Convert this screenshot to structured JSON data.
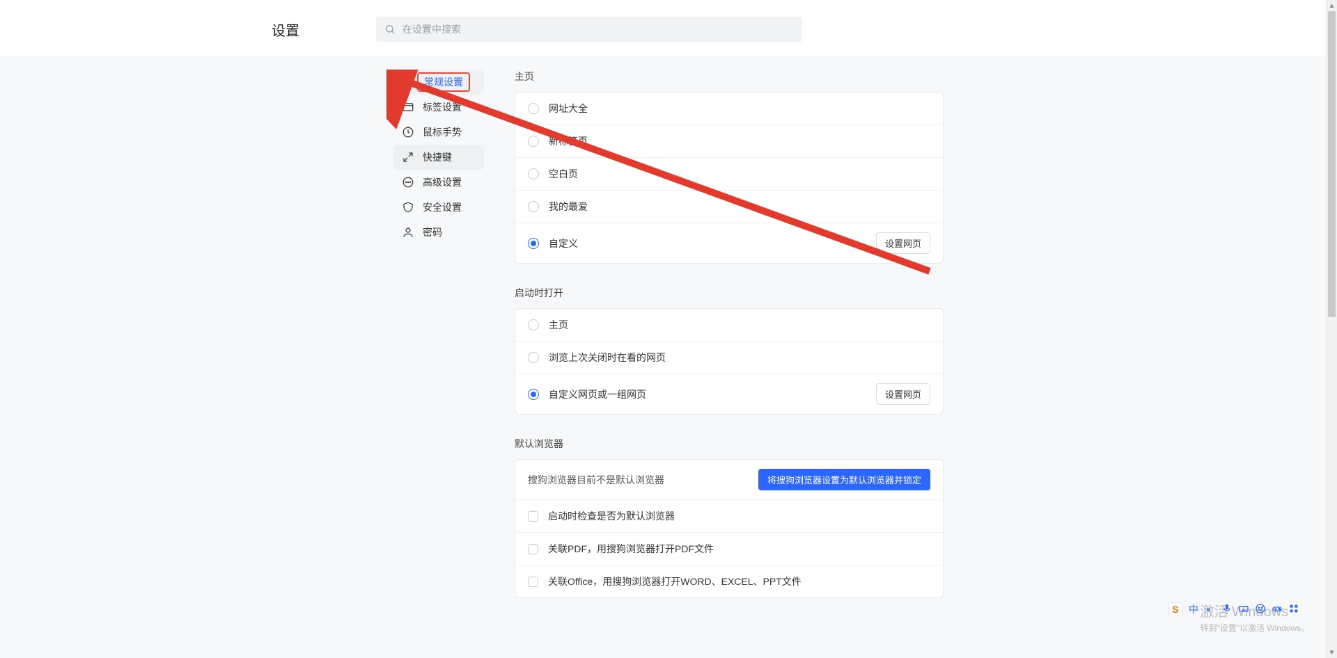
{
  "header": {
    "title": "设置",
    "search_placeholder": "在设置中搜索"
  },
  "sidebar": {
    "items": [
      {
        "id": "general",
        "label": "常规设置"
      },
      {
        "id": "tabs",
        "label": "标签设置"
      },
      {
        "id": "gestures",
        "label": "鼠标手势"
      },
      {
        "id": "shortcuts",
        "label": "快捷键"
      },
      {
        "id": "advanced",
        "label": "高级设置"
      },
      {
        "id": "security",
        "label": "安全设置"
      },
      {
        "id": "password",
        "label": "密码"
      }
    ]
  },
  "sections": {
    "homepage": {
      "title": "主页",
      "options": [
        {
          "label": "网址大全"
        },
        {
          "label": "新标签页"
        },
        {
          "label": "空白页"
        },
        {
          "label": "我的最爱"
        },
        {
          "label": "自定义"
        }
      ],
      "set_button": "设置网页"
    },
    "startup": {
      "title": "启动时打开",
      "options": [
        {
          "label": "主页"
        },
        {
          "label": "浏览上次关闭时在看的网页"
        },
        {
          "label": "自定义网页或一组网页"
        }
      ],
      "set_button": "设置网页"
    },
    "default_browser": {
      "title": "默认浏览器",
      "status_text": "搜狗浏览器目前不是默认浏览器",
      "set_default_button": "将搜狗浏览器设置为默认浏览器并锁定",
      "checks": [
        {
          "label": "启动时检查是否为默认浏览器"
        },
        {
          "label": "关联PDF，用搜狗浏览器打开PDF文件"
        },
        {
          "label": "关联Office，用搜狗浏览器打开WORD、EXCEL、PPT文件"
        }
      ]
    }
  },
  "watermark": {
    "line1": "激活 Windows",
    "line2": "转到\"设置\"以激活 Windows。"
  },
  "ime": {
    "logo": "S",
    "lang": "中"
  }
}
